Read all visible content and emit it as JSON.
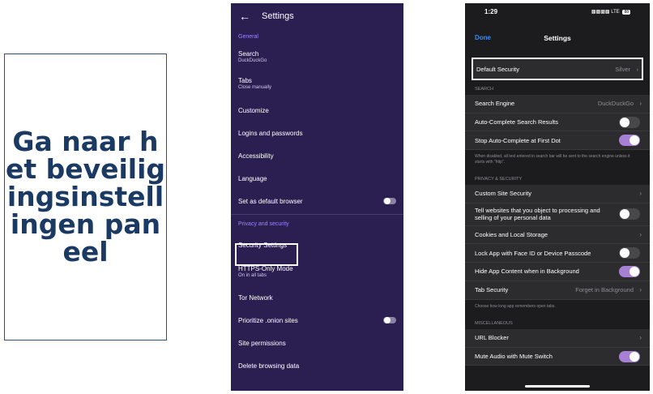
{
  "caption": {
    "text": "Ga naar het beveiligingsinstellingen paneel"
  },
  "android": {
    "header_title": "Settings",
    "back_icon": "arrow-left-icon",
    "sections": {
      "general": "General",
      "privacy": "Privacy and security"
    },
    "items": [
      {
        "label": "Search",
        "sub": "DuckDuckGo"
      },
      {
        "label": "Tabs",
        "sub": "Close manually"
      },
      {
        "label": "Customize",
        "sub": ""
      },
      {
        "label": "Logins and passwords",
        "sub": ""
      },
      {
        "label": "Accessibility",
        "sub": ""
      },
      {
        "label": "Language",
        "sub": ""
      },
      {
        "label": "Set as default browser",
        "sub": "",
        "toggle": false
      }
    ],
    "privacy_items": [
      {
        "label": "Security Settings",
        "sub": ""
      },
      {
        "label": "HTTPS-Only Mode",
        "sub": "On in all tabs"
      },
      {
        "label": "Tor Network",
        "sub": ""
      },
      {
        "label": "Prioritize .onion sites",
        "sub": "",
        "toggle": false
      },
      {
        "label": "Site permissions",
        "sub": ""
      },
      {
        "label": "Delete browsing data",
        "sub": ""
      }
    ]
  },
  "ios": {
    "time": "1:29",
    "network": "LTE",
    "battery": "88",
    "done_label": "Done",
    "title": "Settings",
    "default_security": {
      "label": "Default Security",
      "value": "Silver"
    },
    "search_section": "SEARCH",
    "search_engine": {
      "label": "Search Engine",
      "value": "DuckDuckGo"
    },
    "autocomplete": {
      "label": "Auto-Complete Search Results",
      "on": false
    },
    "stop_autocomplete": {
      "label": "Stop Auto-Complete at First Dot",
      "on": true
    },
    "search_note": "When disabled, all text entered in search bar will be sent to the search engine unless it starts with \"http\".",
    "privacy_section": "PRIVACY & SECURITY",
    "custom_site_security": "Custom Site Security",
    "tell_websites": {
      "label": "Tell websites that you object to processing and selling of your personal data",
      "on": false
    },
    "cookies": "Cookies and Local Storage",
    "lock_app": {
      "label": "Lock App with Face ID or Device Passcode",
      "on": false
    },
    "hide_content": {
      "label": "Hide App Content when in Background",
      "on": true
    },
    "tab_security": {
      "label": "Tab Security",
      "value": "Forget in Background"
    },
    "tab_note": "Choose how long app remembers open tabs.",
    "misc_section": "MISCELLANEOUS",
    "url_blocker": "URL Blocker",
    "mute_audio": {
      "label": "Mute Audio with Mute Switch",
      "on": true
    },
    "colors": {
      "accent": "#a77fd3",
      "link": "#3b8cf5",
      "android_bg": "#2b1f52",
      "android_section": "#9b86ff"
    }
  }
}
